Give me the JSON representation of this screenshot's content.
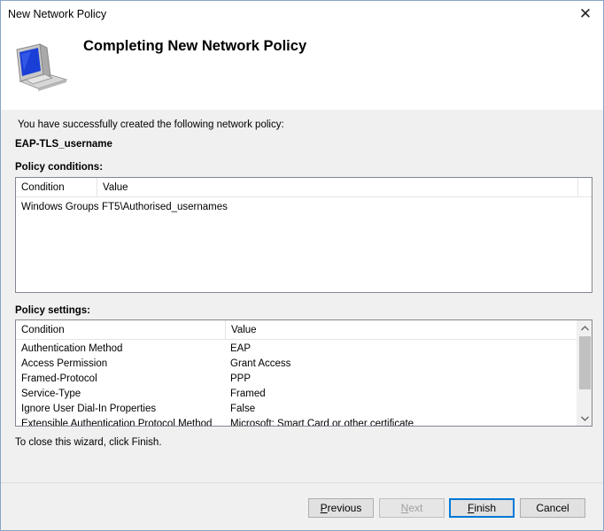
{
  "window": {
    "title": "New Network Policy"
  },
  "header": {
    "title": "Completing New Network Policy",
    "icon": "network-policy-monitor-icon"
  },
  "intro": "You have successfully created the following network policy:",
  "policy_name": "EAP-TLS_username",
  "conditions": {
    "label": "Policy conditions:",
    "columns": [
      "Condition",
      "Value"
    ],
    "rows": [
      {
        "condition": "Windows Groups",
        "value": "FT5\\Authorised_usernames"
      }
    ]
  },
  "settings": {
    "label": "Policy settings:",
    "columns": [
      "Condition",
      "Value"
    ],
    "rows": [
      {
        "condition": "Authentication Method",
        "value": "EAP"
      },
      {
        "condition": "Access Permission",
        "value": "Grant Access"
      },
      {
        "condition": "Framed-Protocol",
        "value": "PPP"
      },
      {
        "condition": "Service-Type",
        "value": "Framed"
      },
      {
        "condition": "Ignore User Dial-In Properties",
        "value": "False"
      },
      {
        "condition": "Extensible Authentication Protocol Method",
        "value": "Microsoft: Smart Card or other certificate"
      }
    ]
  },
  "footer_text": "To close this wizard, click Finish.",
  "buttons": {
    "previous": {
      "first": "P",
      "rest": "revious"
    },
    "next": {
      "first": "N",
      "rest": "ext"
    },
    "finish": {
      "first": "F",
      "rest": "inish"
    },
    "cancel": "Cancel"
  },
  "colors": {
    "default_button_border": "#0078d7",
    "window_background": "#f0f0f0"
  }
}
